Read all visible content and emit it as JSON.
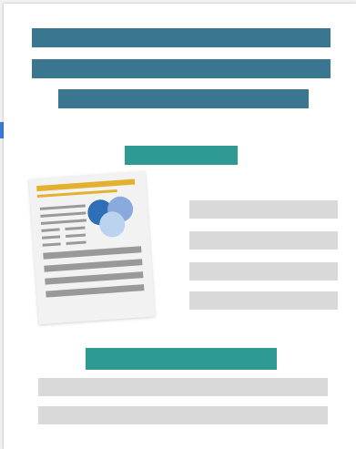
{
  "colors": {
    "title_bar": "#3b7690",
    "section_bar": "#2f9a94",
    "placeholder_line": "#d9d9d9",
    "thumbnail_accent": "#e2b22f",
    "thumbnail_circle_1": "#2f6fb5",
    "thumbnail_circle_2": "#8aa9dc",
    "thumbnail_circle_3": "#bcd3f0",
    "side_marker": "#3a7bd5"
  },
  "illustration": {
    "icon": "document-thumbnail-icon"
  }
}
